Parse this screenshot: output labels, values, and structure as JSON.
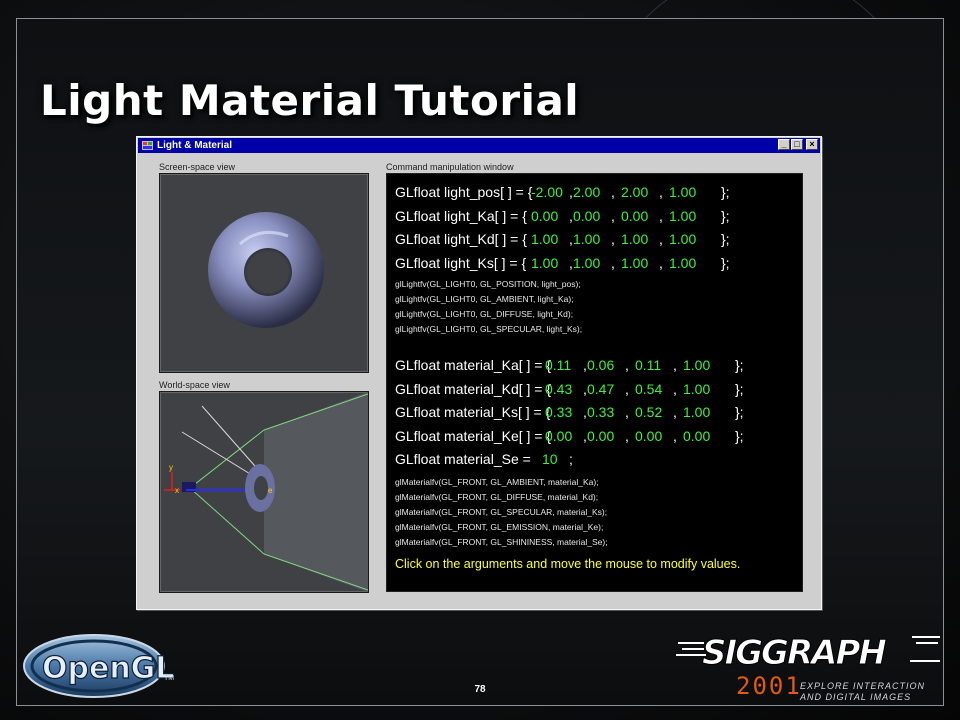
{
  "slide": {
    "title": "Light Material Tutorial",
    "page_number": "78"
  },
  "window": {
    "title": "Light & Material",
    "screen_view_label": "Screen-space view",
    "world_view_label": "World-space view",
    "command_label": "Command manipulation window",
    "minimize": "_",
    "maximize": "□",
    "close": "×"
  },
  "axes": {
    "y": "y",
    "x": "x",
    "e": "e"
  },
  "light_vars": [
    {
      "decl": "GLfloat light_pos[ ] = {",
      "values": [
        "-2.00",
        "2.00",
        "2.00",
        "1.00"
      ]
    },
    {
      "decl": "GLfloat light_Ka[ ] = {",
      "values": [
        "0.00",
        "0.00",
        "0.00",
        "1.00"
      ]
    },
    {
      "decl": "GLfloat light_Kd[ ] = {",
      "values": [
        "1.00",
        "1.00",
        "1.00",
        "1.00"
      ]
    },
    {
      "decl": "GLfloat light_Ks[ ] = {",
      "values": [
        "1.00",
        "1.00",
        "1.00",
        "1.00"
      ]
    }
  ],
  "light_calls": [
    "glLightfv(GL_LIGHT0, GL_POSITION, light_pos);",
    "glLightfv(GL_LIGHT0, GL_AMBIENT, light_Ka);",
    "glLightfv(GL_LIGHT0, GL_DIFFUSE, light_Kd);",
    "glLightfv(GL_LIGHT0, GL_SPECULAR, light_Ks);"
  ],
  "material_vars": [
    {
      "decl": "GLfloat material_Ka[ ] = {",
      "values": [
        "0.11",
        "0.06",
        "0.11",
        "1.00"
      ]
    },
    {
      "decl": "GLfloat material_Kd[ ] = {",
      "values": [
        "0.43",
        "0.47",
        "0.54",
        "1.00"
      ]
    },
    {
      "decl": "GLfloat material_Ks[ ] = {",
      "values": [
        "0.33",
        "0.33",
        "0.52",
        "1.00"
      ]
    },
    {
      "decl": "GLfloat material_Ke[ ] = {",
      "values": [
        "0.00",
        "0.00",
        "0.00",
        "0.00"
      ]
    }
  ],
  "shininess": {
    "decl": "GLfloat material_Se =",
    "value": "10"
  },
  "material_calls": [
    "glMaterialfv(GL_FRONT, GL_AMBIENT, material_Ka);",
    "glMaterialfv(GL_FRONT, GL_DIFFUSE, material_Kd);",
    "glMaterialfv(GL_FRONT, GL_SPECULAR, material_Ks);",
    "glMaterialfv(GL_FRONT, GL_EMISSION, material_Ke);",
    "glMaterialfv(GL_FRONT, GL_SHININESS, material_Se);"
  ],
  "hint": "Click on the arguments and move the mouse to modify values.",
  "logos": {
    "opengl": "OpenGL",
    "opengl_tm": "TM",
    "siggraph": "SIGGRAPH",
    "year": "2001",
    "tagline_1": "EXPLORE INTERACTION",
    "tagline_2": "AND DIGITAL IMAGES"
  },
  "colors": {
    "value_green": "#3ef23e",
    "hint_yellow": "#ffff2a",
    "titlebar_blue": "#0000a8",
    "torus_blue": "#8a90c0"
  }
}
